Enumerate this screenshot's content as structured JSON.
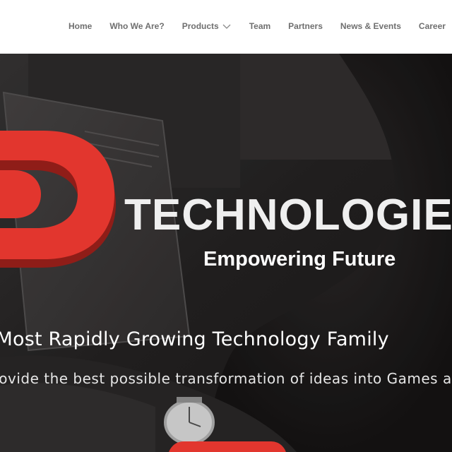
{
  "nav": {
    "items": [
      {
        "label": "Home"
      },
      {
        "label": "Who We Are?"
      },
      {
        "label": "Products",
        "has_dropdown": true
      },
      {
        "label": "Team"
      },
      {
        "label": "Partners"
      },
      {
        "label": "News & Events"
      },
      {
        "label": "Career"
      }
    ]
  },
  "hero": {
    "brand_word": "TECHNOLOGIES",
    "tagline": "Empowering Future",
    "headline": "Pakistan’s Most Rapidly Growing Technology Family",
    "subline": "We provide the best possible transformation of ideas into Games and Apps",
    "accent_color": "#e2362e"
  },
  "icons": {
    "dropdown": "chevron-down-icon",
    "logo": "d-logo-mark"
  }
}
